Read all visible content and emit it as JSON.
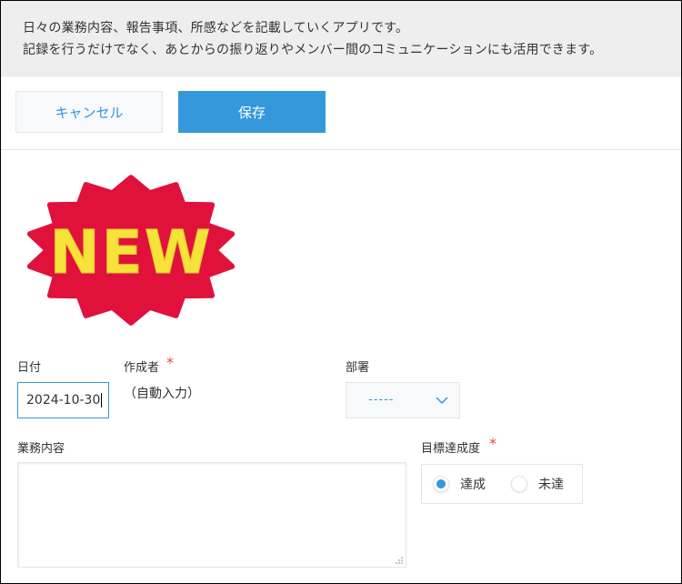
{
  "description": {
    "line1": "日々の業務内容、報告事項、所感などを記載していくアプリです。",
    "line2": "記録を行うだけでなく、あとからの振り返りやメンバー間のコミュニケーションにも活用できます。"
  },
  "toolbar": {
    "cancel_label": "キャンセル",
    "save_label": "保存"
  },
  "image": {
    "text": "NEW",
    "burst_color": "#e0123c",
    "text_color": "#f7e23a"
  },
  "fields": {
    "date": {
      "label": "日付",
      "value": "2024-10-30"
    },
    "author": {
      "label": "作成者",
      "required_mark": "*",
      "value": "（自動入力）"
    },
    "department": {
      "label": "部署",
      "selected": "-----"
    },
    "work": {
      "label": "業務内容",
      "value": ""
    },
    "goal": {
      "label": "目標達成度",
      "required_mark": "*",
      "options": [
        "達成",
        "未達"
      ],
      "selected": "達成"
    }
  },
  "colors": {
    "accent": "#3498db",
    "required": "#e74c3c"
  }
}
